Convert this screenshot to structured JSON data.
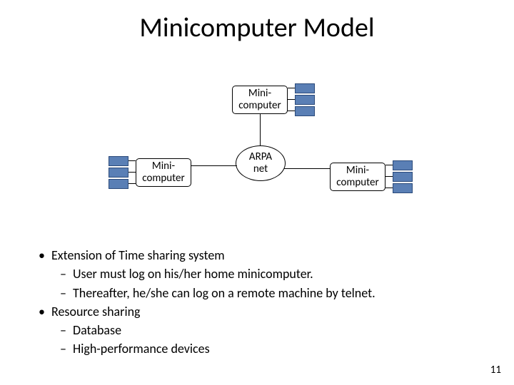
{
  "title": "Minicomputer Model",
  "diagram": {
    "top_node": "Mini-\ncomputer",
    "left_node": "Mini-\ncomputer",
    "right_node": "Mini-\ncomputer",
    "center_node": "ARPA\nnet"
  },
  "bullets": {
    "b1": "Extension of Time sharing system",
    "b1a": "User must log on his/her home minicomputer.",
    "b1b": "Thereafter, he/she can log on a remote machine by telnet.",
    "b2": "Resource sharing",
    "b2a": "Database",
    "b2b": "High-performance devices"
  },
  "page_number": "11"
}
